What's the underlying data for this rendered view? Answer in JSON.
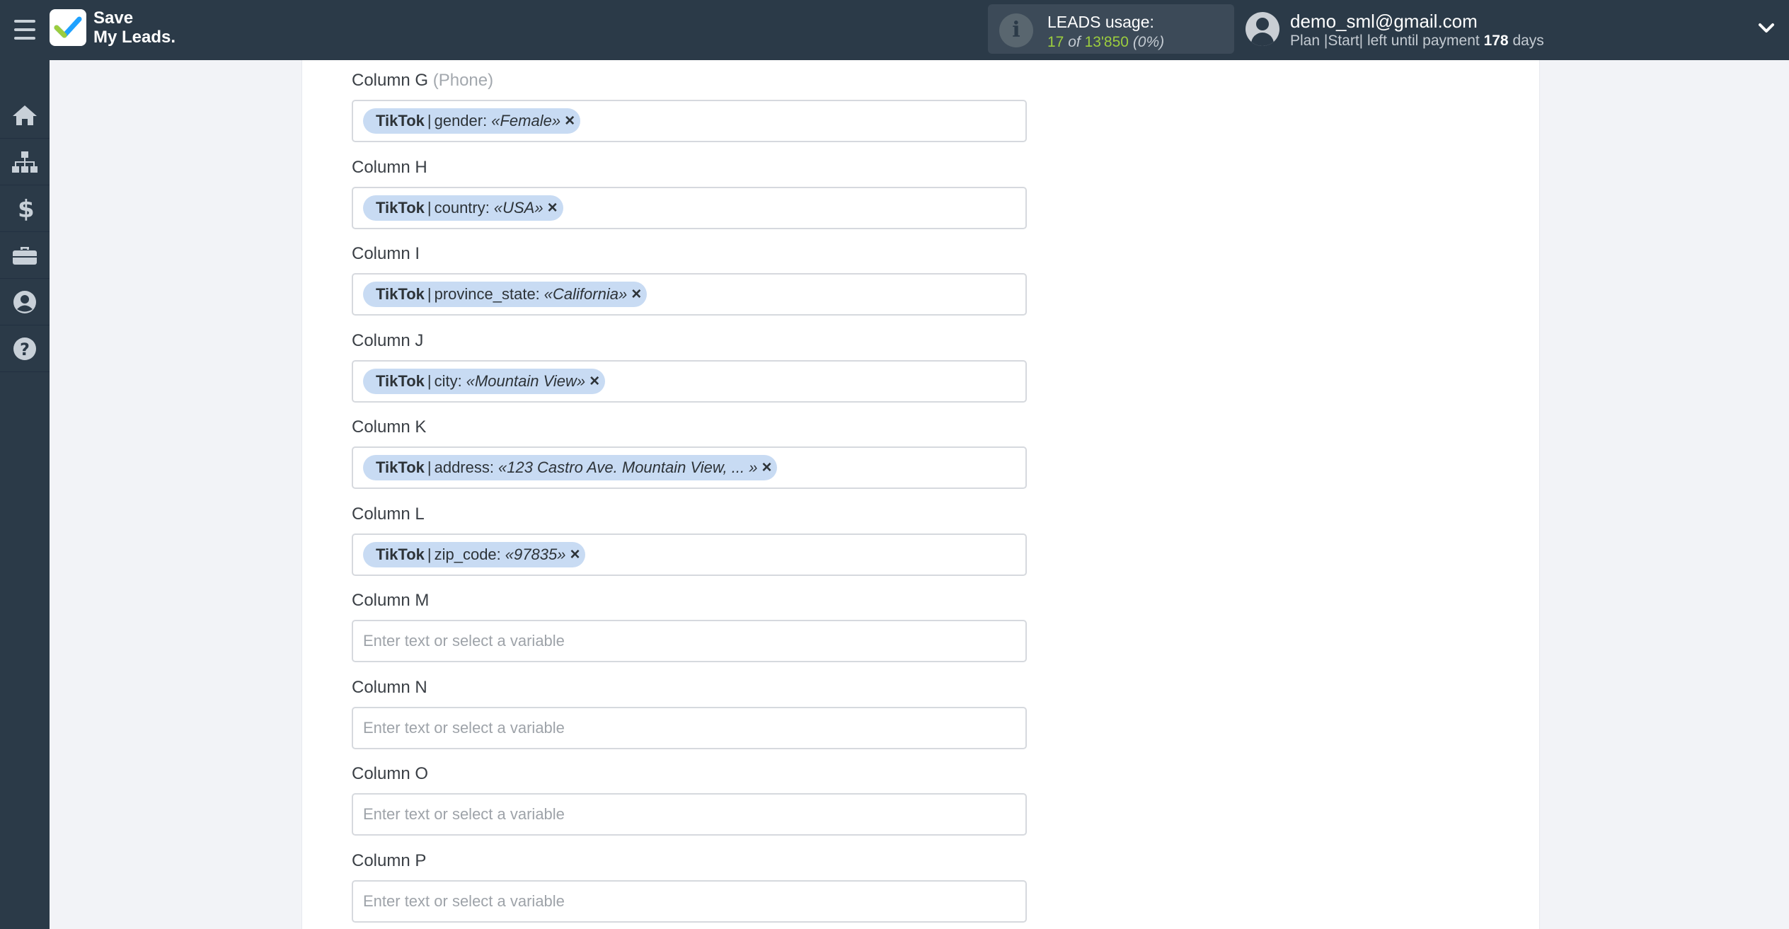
{
  "header": {
    "logo_line1": "Save",
    "logo_line2": "My Leads.",
    "leads_title": "LEADS usage:",
    "leads_used": "17",
    "leads_of": "of",
    "leads_total": "13'850",
    "leads_pct": "(0%)",
    "user_email": "demo_sml@gmail.com",
    "plan_text": "Plan |Start| left until payment",
    "plan_days": "178",
    "plan_days_suffix": "days"
  },
  "sidebar": {
    "items": [
      {
        "icon": "home-icon"
      },
      {
        "icon": "sitemap-icon"
      },
      {
        "icon": "dollar-icon"
      },
      {
        "icon": "briefcase-icon"
      },
      {
        "icon": "user-circle-icon"
      },
      {
        "icon": "help-icon"
      }
    ]
  },
  "fields": [
    {
      "label": "Column G",
      "hint": "(Phone)",
      "tag": {
        "source": "TikTok",
        "field": "gender:",
        "value": "«Female»"
      }
    },
    {
      "label": "Column H",
      "hint": "",
      "tag": {
        "source": "TikTok",
        "field": "country:",
        "value": "«USA»"
      }
    },
    {
      "label": "Column I",
      "hint": "",
      "tag": {
        "source": "TikTok",
        "field": "province_state:",
        "value": "«California»"
      }
    },
    {
      "label": "Column J",
      "hint": "",
      "tag": {
        "source": "TikTok",
        "field": "city:",
        "value": "«Mountain View»"
      }
    },
    {
      "label": "Column K",
      "hint": "",
      "tag": {
        "source": "TikTok",
        "field": "address:",
        "value": "«123 Castro Ave. Mountain View, ... »"
      }
    },
    {
      "label": "Column L",
      "hint": "",
      "tag": {
        "source": "TikTok",
        "field": "zip_code:",
        "value": "«97835»"
      }
    },
    {
      "label": "Column M",
      "placeholder": "Enter text or select a variable"
    },
    {
      "label": "Column N",
      "placeholder": "Enter text or select a variable"
    },
    {
      "label": "Column O",
      "placeholder": "Enter text or select a variable"
    },
    {
      "label": "Column P",
      "placeholder": "Enter text or select a variable"
    }
  ],
  "tag_separator": "|",
  "tag_remove_symbol": "×",
  "colors": {
    "header_bg": "#2b3a48",
    "tag_bg": "#c8dbf3",
    "accent_green": "#9ccd3e"
  }
}
